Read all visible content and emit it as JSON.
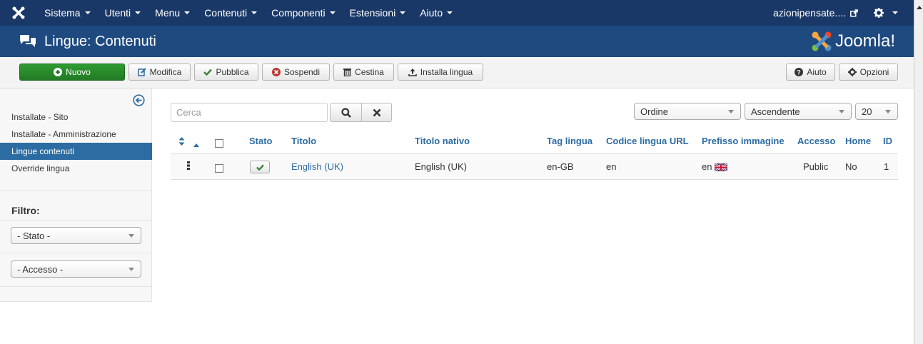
{
  "navbar": {
    "menu": [
      "Sistema",
      "Utenti",
      "Menu",
      "Contenuti",
      "Componenti",
      "Estensioni",
      "Aiuto"
    ],
    "site_name": "azionipensate....",
    "icons": [
      "joomla-x-icon",
      "external-link-icon",
      "gear-icon"
    ]
  },
  "header": {
    "title": "Lingue: Contenuti",
    "brand": "Joomla!",
    "icon": "comments-icon"
  },
  "toolbar": {
    "new": "Nuovo",
    "edit": "Modifica",
    "publish": "Pubblica",
    "unpublish": "Sospendi",
    "trash": "Cestina",
    "install": "Installa lingua",
    "help": "Aiuto",
    "options": "Opzioni"
  },
  "sidebar": {
    "items": [
      {
        "label": "Installate - Sito",
        "active": false
      },
      {
        "label": "Installate - Amministrazione",
        "active": false
      },
      {
        "label": "Lingue contenuti",
        "active": true
      },
      {
        "label": "Override lingua",
        "active": false
      }
    ],
    "filter_label": "Filtro:",
    "state_filter": "- Stato -",
    "access_filter": "- Accesso -"
  },
  "search": {
    "placeholder": "Cerca"
  },
  "list_controls": {
    "order_by": "Ordine",
    "direction": "Ascendente",
    "limit": "20"
  },
  "table": {
    "headers": {
      "status": "Stato",
      "title": "Titolo",
      "native_title": "Titolo nativo",
      "lang_tag": "Tag lingua",
      "url_code": "Codice lingua URL",
      "image_prefix": "Prefisso immagine",
      "access": "Accesso",
      "home": "Home",
      "id": "ID"
    },
    "rows": [
      {
        "title": "English (UK)",
        "native_title": "English (UK)",
        "lang_tag": "en-GB",
        "url_code": "en",
        "image_prefix": "en",
        "access": "Public",
        "home": "No",
        "id": "1",
        "published": true
      }
    ]
  },
  "colors": {
    "navbar": "#1a3867",
    "header": "#1e4a80",
    "new_button": "#2f9b32",
    "link": "#2d6ca2",
    "sidebar_active": "#2d6ca2"
  }
}
